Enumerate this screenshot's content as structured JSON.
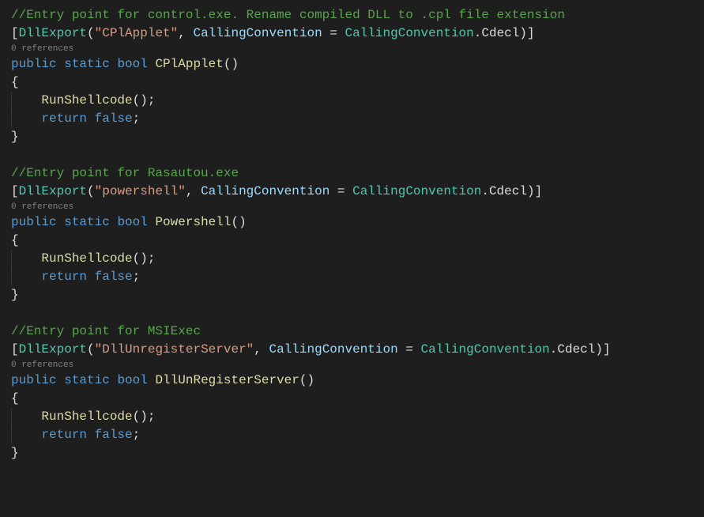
{
  "code": {
    "block1": {
      "comment": "//Entry point for control.exe. Rename compiled DLL to .cpl file extension",
      "attrOpen": "[",
      "attrType": "DllExport",
      "attrParen1": "(",
      "attrStr": "\"CPlApplet\"",
      "attrComma": ", ",
      "attrArgName": "CallingConvention",
      "attrEq": " = ",
      "attrEnumType": "CallingConvention",
      "attrDot": ".",
      "attrEnumVal": "Cdecl",
      "attrParen2": ")",
      "attrClose": "]",
      "codelens": "0 references",
      "kwPublic": "public",
      "kwStatic": "static",
      "kwBool": "bool",
      "methodName": "CPlApplet",
      "sigParens": "()",
      "braceOpen": "{",
      "callName": "RunShellcode",
      "callParens": "();",
      "kwReturn": "return",
      "kwFalse": "false",
      "retSemi": ";",
      "braceClose": "}"
    },
    "block2": {
      "comment": "//Entry point for Rasautou.exe",
      "attrOpen": "[",
      "attrType": "DllExport",
      "attrParen1": "(",
      "attrStr": "\"powershell\"",
      "attrComma": ", ",
      "attrArgName": "CallingConvention",
      "attrEq": " = ",
      "attrEnumType": "CallingConvention",
      "attrDot": ".",
      "attrEnumVal": "Cdecl",
      "attrParen2": ")",
      "attrClose": "]",
      "codelens": "0 references",
      "kwPublic": "public",
      "kwStatic": "static",
      "kwBool": "bool",
      "methodName": "Powershell",
      "sigParens": "()",
      "braceOpen": "{",
      "callName": "RunShellcode",
      "callParens": "();",
      "kwReturn": "return",
      "kwFalse": "false",
      "retSemi": ";",
      "braceClose": "}"
    },
    "block3": {
      "comment": "//Entry point for MSIExec",
      "attrOpen": "[",
      "attrType": "DllExport",
      "attrParen1": "(",
      "attrStr": "\"DllUnregisterServer\"",
      "attrComma": ", ",
      "attrArgName": "CallingConvention",
      "attrEq": " = ",
      "attrEnumType": "CallingConvention",
      "attrDot": ".",
      "attrEnumVal": "Cdecl",
      "attrParen2": ")",
      "attrClose": "]",
      "codelens": "0 references",
      "kwPublic": "public",
      "kwStatic": "static",
      "kwBool": "bool",
      "methodName": "DllUnRegisterServer",
      "sigParens": "()",
      "braceOpen": "{",
      "callName": "RunShellcode",
      "callParens": "();",
      "kwReturn": "return",
      "kwFalse": "false",
      "retSemi": ";",
      "braceClose": "}"
    }
  }
}
